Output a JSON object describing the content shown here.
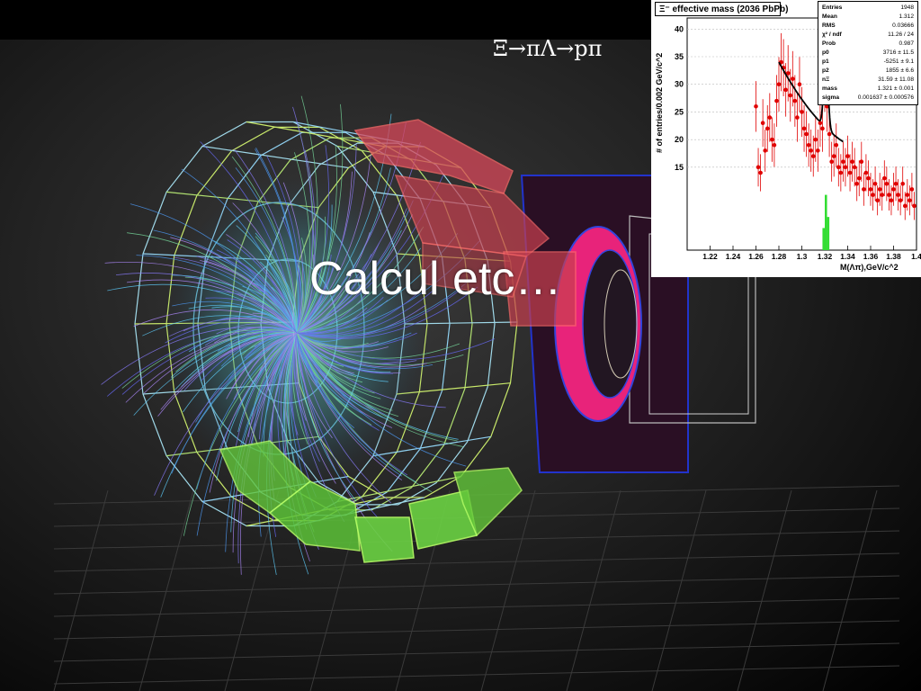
{
  "slide": {
    "title": "Calcul etc…",
    "formula": "Ξ→πΛ→pπ"
  },
  "histogram": {
    "title": "Ξ⁻ effective mass (2036 PbPb)",
    "stats": [
      {
        "key": "Entries",
        "value": "1948"
      },
      {
        "key": "Mean",
        "value": "1.312"
      },
      {
        "key": "RMS",
        "value": "0.03666"
      },
      {
        "key": "χ² / ndf",
        "value": "11.26 / 24"
      },
      {
        "key": "Prob",
        "value": "0.987"
      },
      {
        "key": "p0",
        "value": "3716 ± 11.5"
      },
      {
        "key": "p1",
        "value": "-5251 ± 9.1"
      },
      {
        "key": "p2",
        "value": "1855 ± 6.6"
      },
      {
        "key": "nΞ",
        "value": "31.59 ± 11.08"
      },
      {
        "key": "mass",
        "value": "1.321 ± 0.001"
      },
      {
        "key": "sigma",
        "value": "0.001637 ± 0.000576"
      }
    ],
    "xlabel": "M(Λπ),GeV/c^2",
    "ylabel": "# of entries/0.002 GeV/c^2",
    "x_ticks": [
      "1.22",
      "1.24",
      "1.26",
      "1.28",
      "1.3",
      "1.32",
      "1.34",
      "1.36",
      "1.38",
      "1.4"
    ],
    "y_ticks": [
      "15",
      "20",
      "25",
      "30",
      "35",
      "40"
    ],
    "xlim": [
      1.2,
      1.4
    ],
    "ylim": [
      0,
      42
    ]
  },
  "colors": {
    "data_points": "#e00000",
    "fit_line": "#000000",
    "signal_fill": "#33dd33",
    "calorimeter_red": "#dd3344",
    "calorimeter_green": "#66dd44",
    "wireframe": "#9fd8e8"
  },
  "chart_data": {
    "type": "scatter",
    "title": "Ξ⁻ effective mass (2036 PbPb)",
    "xlabel": "M(Λπ),GeV/c^2",
    "ylabel": "# of entries/0.002 GeV/c^2",
    "xlim": [
      1.2,
      1.4
    ],
    "ylim": [
      0,
      42
    ],
    "series": [
      {
        "values_x": [
          1.26,
          1.262,
          1.264,
          1.266,
          1.268,
          1.27,
          1.272,
          1.274,
          1.276,
          1.278,
          1.28,
          1.282,
          1.284,
          1.286,
          1.288,
          1.29,
          1.292,
          1.294,
          1.296,
          1.298,
          1.3,
          1.302,
          1.304,
          1.306,
          1.308,
          1.31,
          1.312,
          1.314,
          1.316,
          1.318,
          1.32,
          1.322,
          1.324,
          1.326,
          1.328,
          1.33,
          1.332,
          1.334,
          1.336,
          1.338,
          1.34,
          1.342,
          1.344,
          1.346,
          1.348,
          1.35,
          1.352,
          1.354,
          1.356,
          1.358,
          1.36,
          1.362,
          1.364,
          1.366,
          1.368,
          1.37,
          1.372,
          1.374,
          1.376,
          1.378,
          1.38,
          1.382,
          1.384,
          1.386,
          1.388,
          1.39,
          1.392,
          1.394,
          1.396,
          1.398
        ],
        "values_y": [
          26,
          15,
          14,
          23,
          18,
          22,
          24,
          20,
          19,
          27,
          30,
          34,
          33,
          29,
          32,
          28,
          31,
          27,
          24,
          30,
          25,
          22,
          21,
          19,
          18,
          17,
          20,
          18,
          23,
          22,
          30,
          26,
          21,
          16,
          17,
          19,
          15,
          14,
          16,
          15,
          17,
          14,
          16,
          15,
          12,
          13,
          16,
          11,
          14,
          13,
          11,
          10,
          12,
          9,
          11,
          10,
          13,
          12,
          10,
          9,
          11,
          12,
          10,
          9,
          12,
          8,
          10,
          9,
          11,
          8
        ]
      }
    ],
    "signal_fit_x_range": [
      1.28,
      1.336
    ]
  }
}
